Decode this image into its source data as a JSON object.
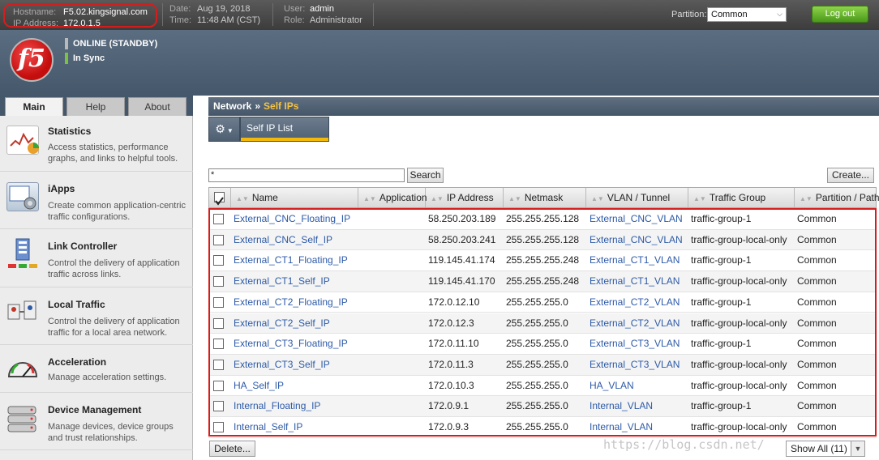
{
  "topbar": {
    "hostname_label": "Hostname:",
    "hostname": "F5.02.kingsignal.com",
    "ip_label": "IP Address:",
    "ip": "172.0.1.5",
    "date_label": "Date:",
    "date": "Aug 19, 2018",
    "time_label": "Time:",
    "time": "11:48 AM (CST)",
    "user_label": "User:",
    "user": "admin",
    "role_label": "Role:",
    "role": "Administrator",
    "partition_label": "Partition:",
    "partition_value": "Common",
    "logout_label": "Log out"
  },
  "header": {
    "logo_text": "f5",
    "status1": "ONLINE (STANDBY)",
    "status2": "In Sync",
    "status1_color": "#b9b9b9",
    "status2_color": "#7cc242"
  },
  "tabs": [
    "Main",
    "Help",
    "About"
  ],
  "nav": [
    {
      "title": "Statistics",
      "desc": "Access statistics, performance graphs, and links to helpful tools."
    },
    {
      "title": "iApps",
      "desc": "Create common application-centric traffic configurations."
    },
    {
      "title": "Link Controller",
      "desc": "Control the delivery of application traffic across links."
    },
    {
      "title": "Local Traffic",
      "desc": "Control the delivery of application traffic for a local area network."
    },
    {
      "title": "Acceleration",
      "desc": "Manage acceleration settings."
    },
    {
      "title": "Device Management",
      "desc": "Manage devices, device groups and trust relationships."
    }
  ],
  "breadcrumb": {
    "section": "Network",
    "separator": "»",
    "page": "Self IPs"
  },
  "subtab": {
    "label": "Self IP List"
  },
  "search": {
    "value": "*",
    "button": "Search"
  },
  "create_label": "Create...",
  "table": {
    "columns": [
      "Name",
      "Application",
      "IP Address",
      "Netmask",
      "VLAN / Tunnel",
      "Traffic Group",
      "Partition / Path"
    ],
    "rows": [
      {
        "name": "External_CNC_Floating_IP",
        "ip": "58.250.203.189",
        "netmask": "255.255.255.128",
        "vlan": "External_CNC_VLAN",
        "traffic_group": "traffic-group-1",
        "partition": "Common"
      },
      {
        "name": "External_CNC_Self_IP",
        "ip": "58.250.203.241",
        "netmask": "255.255.255.128",
        "vlan": "External_CNC_VLAN",
        "traffic_group": "traffic-group-local-only",
        "partition": "Common"
      },
      {
        "name": "External_CT1_Floating_IP",
        "ip": "119.145.41.174",
        "netmask": "255.255.255.248",
        "vlan": "External_CT1_VLAN",
        "traffic_group": "traffic-group-1",
        "partition": "Common"
      },
      {
        "name": "External_CT1_Self_IP",
        "ip": "119.145.41.170",
        "netmask": "255.255.255.248",
        "vlan": "External_CT1_VLAN",
        "traffic_group": "traffic-group-local-only",
        "partition": "Common"
      },
      {
        "name": "External_CT2_Floating_IP",
        "ip": "172.0.12.10",
        "netmask": "255.255.255.0",
        "vlan": "External_CT2_VLAN",
        "traffic_group": "traffic-group-1",
        "partition": "Common"
      },
      {
        "name": "External_CT2_Self_IP",
        "ip": "172.0.12.3",
        "netmask": "255.255.255.0",
        "vlan": "External_CT2_VLAN",
        "traffic_group": "traffic-group-local-only",
        "partition": "Common"
      },
      {
        "name": "External_CT3_Floating_IP",
        "ip": "172.0.11.10",
        "netmask": "255.255.255.0",
        "vlan": "External_CT3_VLAN",
        "traffic_group": "traffic-group-1",
        "partition": "Common"
      },
      {
        "name": "External_CT3_Self_IP",
        "ip": "172.0.11.3",
        "netmask": "255.255.255.0",
        "vlan": "External_CT3_VLAN",
        "traffic_group": "traffic-group-local-only",
        "partition": "Common"
      },
      {
        "name": "HA_Self_IP",
        "ip": "172.0.10.3",
        "netmask": "255.255.255.0",
        "vlan": "HA_VLAN",
        "traffic_group": "traffic-group-local-only",
        "partition": "Common"
      },
      {
        "name": "Internal_Floating_IP",
        "ip": "172.0.9.1",
        "netmask": "255.255.255.0",
        "vlan": "Internal_VLAN",
        "traffic_group": "traffic-group-1",
        "partition": "Common"
      },
      {
        "name": "Internal_Self_IP",
        "ip": "172.0.9.3",
        "netmask": "255.255.255.0",
        "vlan": "Internal_VLAN",
        "traffic_group": "traffic-group-local-only",
        "partition": "Common"
      }
    ]
  },
  "footer": {
    "delete_label": "Delete...",
    "show_all_label": "Show All (11)"
  },
  "watermark": "https://blog.csdn.net/"
}
